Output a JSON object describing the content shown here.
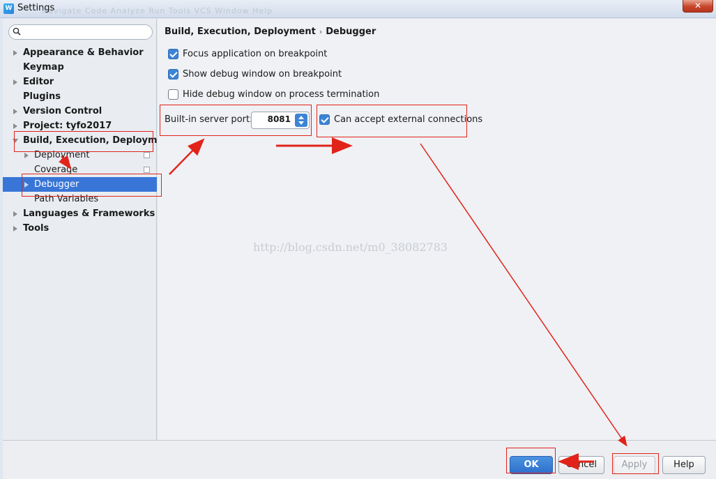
{
  "window": {
    "title": "Settings",
    "app_icon_letter": "W",
    "close_symbol": "✕",
    "ghost_menu": "Navigate  Code  Analyze  Run  Tools  VCS  Window  Help"
  },
  "search": {
    "placeholder": "",
    "value": ""
  },
  "sidebar": {
    "items": [
      {
        "label": "Appearance & Behavior"
      },
      {
        "label": "Keymap"
      },
      {
        "label": "Editor"
      },
      {
        "label": "Plugins"
      },
      {
        "label": "Version Control"
      },
      {
        "label": "Project: tyfo2017"
      },
      {
        "label": "Build, Execution, Deployment"
      },
      {
        "label": "Deployment"
      },
      {
        "label": "Coverage"
      },
      {
        "label": "Debugger"
      },
      {
        "label": "Path Variables"
      },
      {
        "label": "Languages & Frameworks"
      },
      {
        "label": "Tools"
      }
    ]
  },
  "main": {
    "breadcrumb": {
      "parent": "Build, Execution, Deployment",
      "separator": "›",
      "current": "Debugger"
    },
    "options": [
      {
        "label": "Focus application on breakpoint",
        "checked": true
      },
      {
        "label": "Show debug window on breakpoint",
        "checked": true
      },
      {
        "label": "Hide debug window on process termination",
        "checked": false
      }
    ],
    "port": {
      "label": "Built-in server port:",
      "value": "8081"
    },
    "external": {
      "label": "Can accept external connections",
      "checked": true
    },
    "watermark": "http://blog.csdn.net/m0_38082783"
  },
  "buttons": {
    "ok": "OK",
    "cancel": "Cancel",
    "apply": "Apply",
    "help": "Help"
  },
  "colors": {
    "selection": "#3875d7",
    "checkbox": "#3c84d6",
    "annotation": "#e2231a"
  }
}
